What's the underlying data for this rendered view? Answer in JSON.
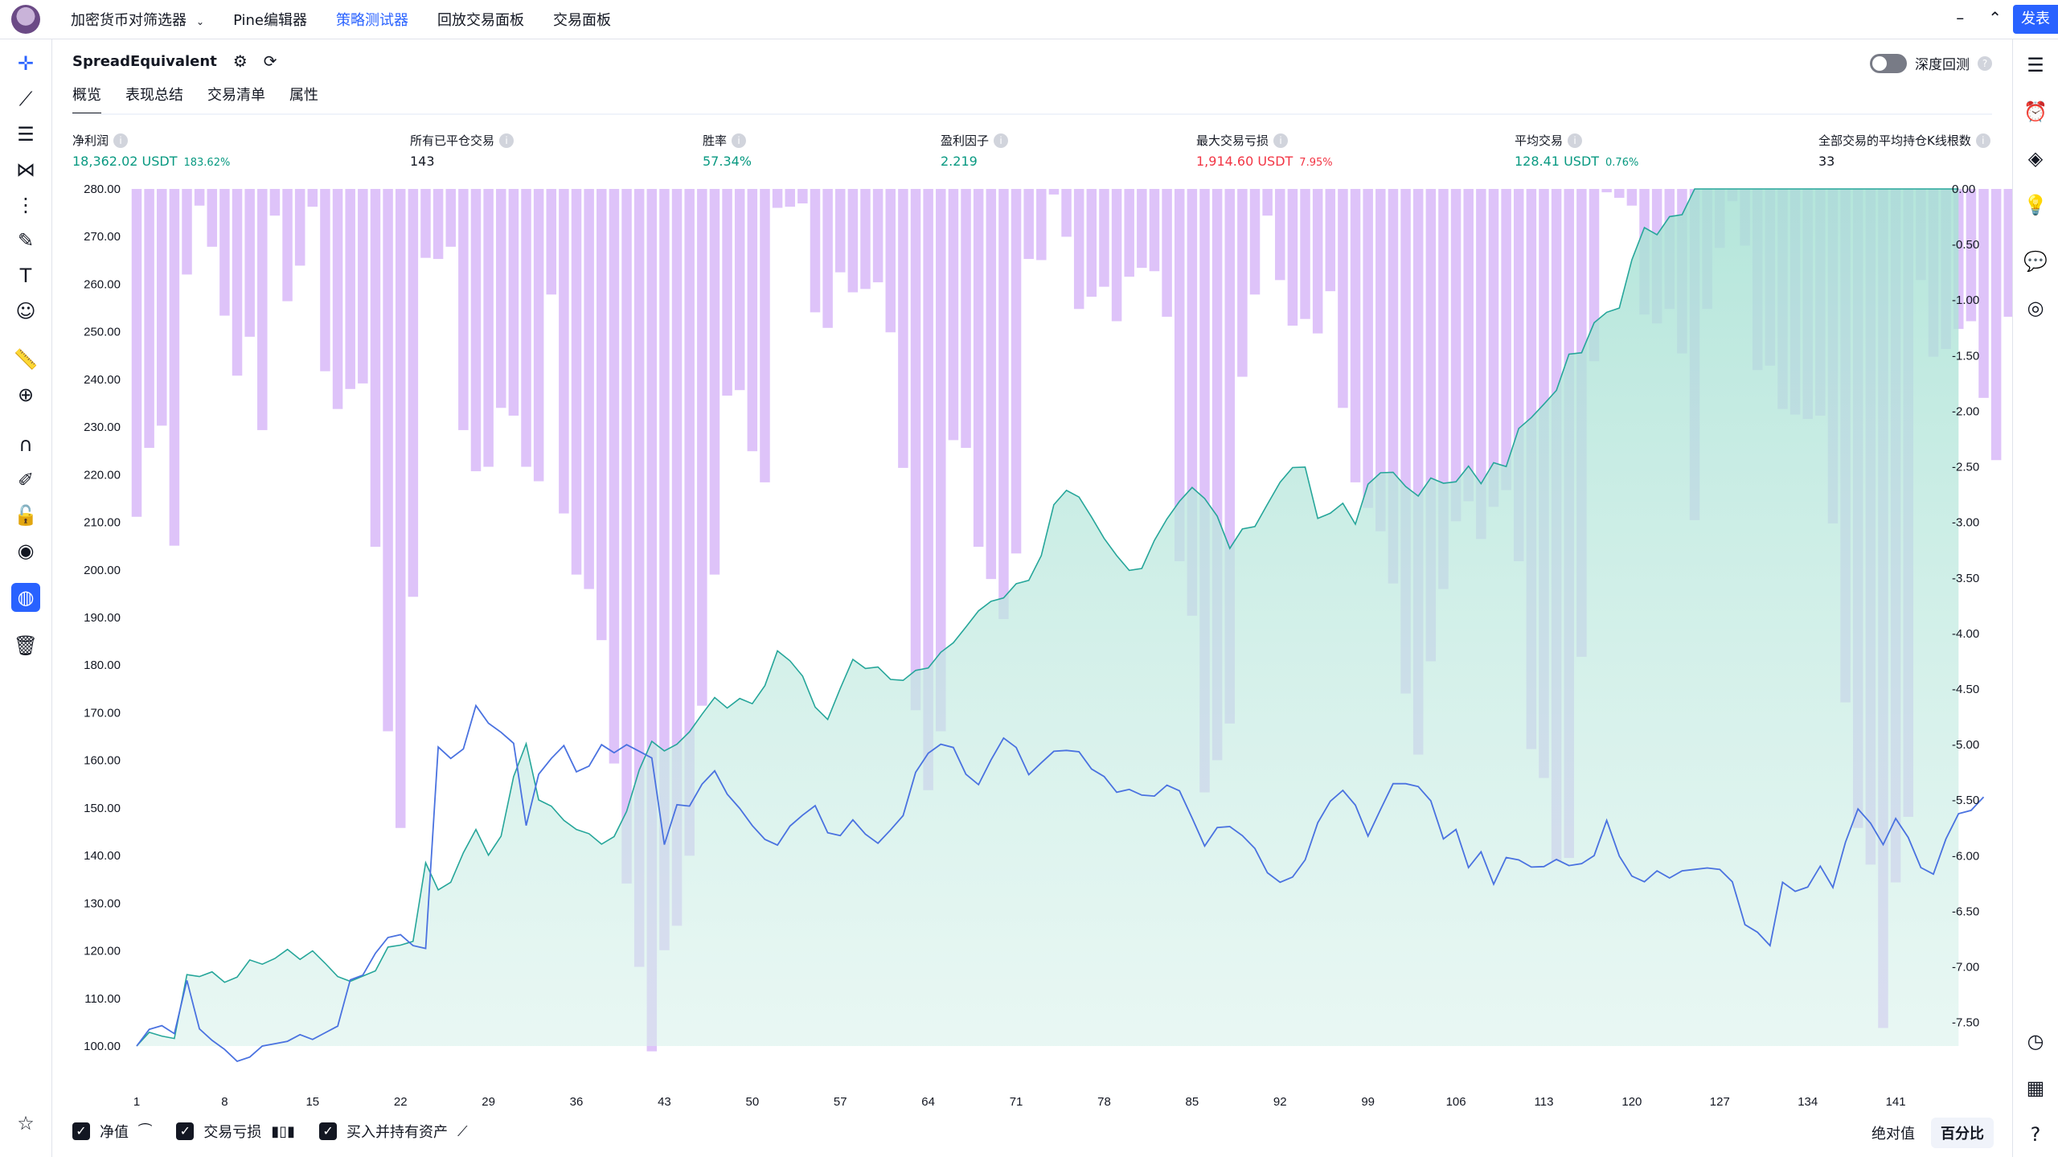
{
  "topbar": {
    "tabs": [
      "加密货币对筛选器",
      "Pine编辑器",
      "策略测试器",
      "回放交易面板",
      "交易面板"
    ],
    "active_tab": "策略测试器",
    "publish_label": "发表"
  },
  "panel": {
    "strategy_name": "SpreadEquivalent",
    "deep_backtest_label": "深度回测",
    "subtabs": [
      "概览",
      "表现总结",
      "交易清单",
      "属性"
    ]
  },
  "metrics": [
    {
      "label": "净利润",
      "value": "18,362.02 USDT",
      "pct": "183.62%",
      "color": "green"
    },
    {
      "label": "所有已平仓交易",
      "value": "143",
      "pct": "",
      "color": "dark"
    },
    {
      "label": "胜率",
      "value": "57.34%",
      "pct": "",
      "color": "green"
    },
    {
      "label": "盈利因子",
      "value": "2.219",
      "pct": "",
      "color": "green"
    },
    {
      "label": "最大交易亏损",
      "value": "1,914.60 USDT",
      "pct": "7.95%",
      "color": "red"
    },
    {
      "label": "平均交易",
      "value": "128.41 USDT",
      "pct": "0.76%",
      "color": "green"
    },
    {
      "label": "全部交易的平均持仓K线根数",
      "value": "33",
      "pct": "",
      "color": "dark"
    }
  ],
  "legend": {
    "equity_label": "净值",
    "drawdown_label": "交易亏损",
    "buyhold_label": "买入并持有资产"
  },
  "mode": {
    "absolute_label": "绝对值",
    "percent_label": "百分比"
  },
  "colors": {
    "accent": "#2962ff",
    "equity": "#26a69a",
    "drawdown": "#d8b8f8",
    "buyhold": "#4a72e0"
  },
  "chart_data": {
    "type": "area",
    "x_ticks": [
      "1",
      "8",
      "15",
      "22",
      "29",
      "36",
      "43",
      "50",
      "57",
      "64",
      "71",
      "78",
      "85",
      "92",
      "99",
      "106",
      "113",
      "120",
      "127",
      "134",
      "141"
    ],
    "y_left_ticks": [
      "280.00",
      "270.00",
      "260.00",
      "250.00",
      "240.00",
      "230.00",
      "220.00",
      "210.00",
      "200.00",
      "190.00",
      "180.00",
      "170.00",
      "160.00",
      "150.00",
      "140.00",
      "130.00",
      "120.00",
      "110.00",
      "100.00"
    ],
    "y_right_ticks": [
      "0.00",
      "-0.50",
      "-1.00",
      "-1.50",
      "-2.00",
      "-2.50",
      "-3.00",
      "-3.50",
      "-4.00",
      "-4.50",
      "-5.00",
      "-5.50",
      "-6.00",
      "-6.50",
      "-7.00",
      "-7.50"
    ],
    "ylim_left": [
      96.8,
      280
    ],
    "ylim_right": [
      -7.85,
      0
    ],
    "x_range": [
      1,
      144
    ],
    "series": [
      {
        "name": "净值",
        "type": "area",
        "axis": "left",
        "values": [
          100,
          102.9,
          102.1,
          101.6,
          115,
          114.6,
          115.6,
          113.4,
          114.5,
          118.1,
          117.2,
          118.4,
          120.3,
          118.2,
          120,
          117.4,
          114.6,
          113.6,
          114.7,
          115.8,
          120.8,
          121.2,
          122,
          138.5,
          132.8,
          134.4,
          140.6,
          145.5,
          140.1,
          144.1,
          156.6,
          163.5,
          151.7,
          150.4,
          147.4,
          145.5,
          144.6,
          142.4,
          144,
          149.3,
          158,
          164,
          162,
          163.4,
          166,
          169.7,
          173.2,
          171,
          173,
          171.9,
          175.7,
          183,
          180.9,
          177.7,
          171.2,
          168.6,
          175.1,
          181.2,
          179.3,
          179.6,
          177,
          176.8,
          178.9,
          179.4,
          182.7,
          184.7,
          188,
          191.4,
          193.4,
          194.1,
          197.1,
          197.8,
          203,
          213.7,
          216.7,
          215.3,
          211.1,
          206.6,
          203,
          199.9,
          200.3,
          206.2,
          210.7,
          214.4,
          217.3,
          215,
          211.3,
          204.5,
          208.6,
          209.1,
          213.8,
          218.4,
          221.5,
          221.6,
          210.8,
          211.9,
          214,
          209.6,
          218,
          220.4,
          220.5,
          217.5,
          215.5,
          219.3,
          218.2,
          218.5,
          221.8,
          218.1,
          222.5,
          221.7,
          229.7,
          232,
          234.8,
          237.7,
          245.3,
          245.6,
          251.9,
          254.1,
          255,
          265.1,
          271.9,
          270.4,
          274.2,
          274.6,
          280.6,
          280.4,
          283.7,
          283.1,
          288.6,
          284.7,
          284.3,
          290.6,
          292.8,
          295.8,
          302.6,
          299.7,
          297.7,
          301.2,
          299.4,
          300.4,
          303.8,
          308.2,
          309.4,
          316.1,
          318.4,
          306.3
        ]
      },
      {
        "name": "交易亏损",
        "type": "bar",
        "axis": "right",
        "values": [
          -2.95,
          -2.33,
          -2.13,
          -3.21,
          -0.77,
          -0.15,
          -0.52,
          -1.14,
          -1.68,
          -1.33,
          -2.17,
          -0.24,
          -1.01,
          -0.69,
          -0.16,
          -1.64,
          -1.98,
          -1.8,
          -1.75,
          -3.22,
          -4.88,
          -5.75,
          -3.67,
          -0.62,
          -0.63,
          -0.52,
          -2.17,
          -2.54,
          -2.5,
          -1.97,
          -2.04,
          -2.5,
          -2.63,
          -0.95,
          -2.92,
          -3.47,
          -3.6,
          -4.06,
          -5.17,
          -6.25,
          -7.0,
          -7.76,
          -6.85,
          -6.63,
          -6.0,
          -4.65,
          -3.47,
          -1.86,
          -1.81,
          -2.36,
          -2.64,
          -0.17,
          -0.16,
          -0.13,
          -1.11,
          -1.25,
          -0.75,
          -0.93,
          -0.9,
          -0.84,
          -1.29,
          -2.51,
          -4.69,
          -5.41,
          -4.88,
          -2.26,
          -2.33,
          -3.22,
          -3.51,
          -3.87,
          -3.28,
          -0.63,
          -0.64,
          -0.05,
          -0.43,
          -1.08,
          -0.97,
          -0.88,
          -1.19,
          -0.79,
          -0.71,
          -0.74,
          -1.15,
          -3.35,
          -3.84,
          -5.43,
          -5.14,
          -4.81,
          -1.69,
          -0.95,
          -0.24,
          -0.82,
          -1.23,
          -1.17,
          -1.3,
          -0.92,
          -1.97,
          -2.64,
          -2.87,
          -3.08,
          -3.55,
          -4.54,
          -5.09,
          -4.25,
          -3.6,
          -2.99,
          -2.81,
          -3.15,
          -2.86,
          -2.71,
          -3.35,
          -5.04,
          -5.3,
          -6.05,
          -6.02,
          -4.21,
          -1.55,
          -0.03,
          -0.08,
          -0.15,
          -1.13,
          -1.21,
          -1.08,
          -1.48,
          -2.98,
          -1.08,
          -0.53,
          -0.11,
          -0.51,
          -1.63,
          -1.59,
          -1.98,
          -2.03,
          -2.07,
          -2.04,
          -3.01,
          -4.62,
          -5.75,
          -6.08,
          -7.55,
          -6.24,
          -5.65,
          -0.82,
          -1.51,
          -1.44,
          -1.26,
          -1.19,
          -1.88,
          -2.44,
          -1.15,
          -1.0
        ]
      },
      {
        "name": "买入并持有资产",
        "type": "line",
        "axis": "left",
        "values": [
          100,
          103.5,
          104.3,
          102.6,
          113.8,
          103.6,
          101.2,
          99.3,
          96.8,
          97.7,
          100,
          100.5,
          101,
          102.4,
          101.4,
          102.8,
          104.2,
          113.9,
          114.9,
          119.5,
          122.8,
          123.4,
          121.1,
          120.5,
          162.8,
          160.4,
          162.4,
          171.5,
          167.8,
          165.9,
          163.6,
          146.3,
          157.1,
          160.4,
          163.1,
          157.6,
          158.8,
          163.3,
          161.6,
          163.3,
          161.9,
          160.5,
          142.3,
          150.7,
          150.4,
          155,
          157.8,
          152.9,
          149.9,
          146.3,
          143.4,
          142.2,
          146.2,
          148.5,
          150.5,
          144.8,
          144.2,
          147.5,
          144.5,
          142.6,
          145.4,
          148.4,
          157.5,
          161.5,
          163.4,
          162.7,
          157.1,
          154.9,
          160.1,
          164.7,
          162.7,
          157,
          159.5,
          161.9,
          162.1,
          161.8,
          158.2,
          156.6,
          153.3,
          153.9,
          152.7,
          152.5,
          154.8,
          153.6,
          147.9,
          142,
          145.9,
          146.1,
          144.2,
          141.5,
          136.4,
          134.4,
          135.5,
          139.1,
          146.9,
          151.4,
          153.7,
          150.6,
          144.1,
          149.7,
          155.1,
          155.1,
          154.5,
          151.5,
          143.5,
          145.5,
          137.5,
          140.8,
          134,
          139.6,
          139.1,
          137.6,
          137.7,
          139.2,
          137.9,
          138.3,
          140,
          147.4,
          139.9,
          135.7,
          134.5,
          136.8,
          135.3,
          136.8,
          137.1,
          137.4,
          137.1,
          134.5,
          125.5,
          123.9,
          121.1,
          134.4,
          132.5,
          133.4,
          137.8,
          133.3,
          142.8,
          149.8,
          146.8,
          142.3,
          147.8,
          143.8,
          137.5,
          136.1,
          143.5,
          148.8,
          149.5,
          152.3
        ]
      }
    ]
  }
}
